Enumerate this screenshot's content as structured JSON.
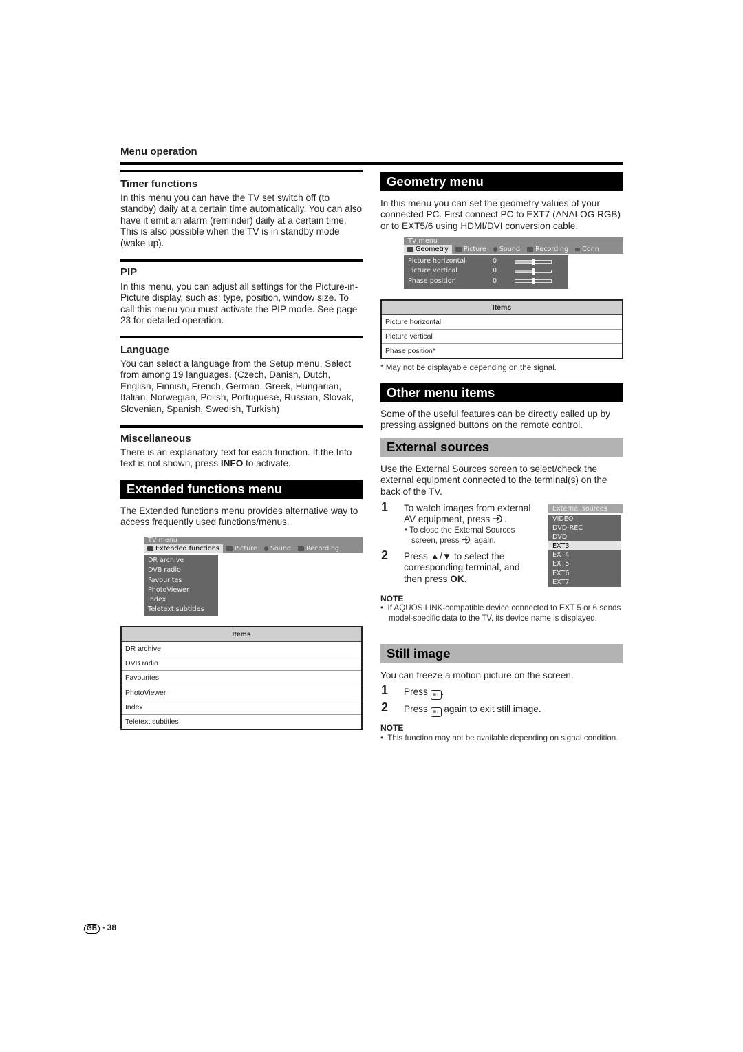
{
  "page": {
    "section_label": "Menu operation",
    "footer": {
      "region_badge": "GB",
      "page_number": "- 38"
    }
  },
  "left": {
    "timer": {
      "heading": "Timer functions",
      "body": "In this menu you can have the TV set switch off (to standby) daily at a certain time automatically. You can also have it emit an alarm (reminder) daily at a certain time. This is also possible when the TV is in standby mode (wake up)."
    },
    "pip": {
      "heading": "PIP",
      "body": "In this menu, you can adjust all settings for the Picture-in-Picture display, such as: type, position, window size. To call this menu you must activate the PIP mode. See page 23 for detailed operation."
    },
    "language": {
      "heading": "Language",
      "body": "You can select a language from the Setup menu. Select from among 19 languages. (Czech, Danish, Dutch, English, Finnish, French, German, Greek, Hungarian, Italian, Norwegian, Polish, Portuguese, Russian, Slovak, Slovenian, Spanish, Swedish, Turkish)"
    },
    "misc": {
      "heading": "Miscellaneous",
      "body_before": "There is an explanatory text for each function. If the Info text is not shown, press ",
      "body_bold": "INFO",
      "body_after": " to activate."
    },
    "extended": {
      "heading": "Extended functions menu",
      "body": "The Extended functions menu provides alternative way to access frequently used functions/menus.",
      "osd": {
        "title": "TV menu",
        "tabs": [
          "Extended functions",
          "Picture",
          "Sound",
          "Recording"
        ],
        "active_tab": "Extended functions",
        "items": [
          "DR archive",
          "DVB radio",
          "Favourites",
          "PhotoViewer",
          "Index",
          "Teletext subtitles"
        ]
      },
      "table": {
        "header": "Items",
        "rows": [
          "DR archive",
          "DVB radio",
          "Favourites",
          "PhotoViewer",
          "Index",
          "Teletext subtitles"
        ]
      }
    }
  },
  "right": {
    "geometry": {
      "heading": "Geometry menu",
      "body": "In this menu you can set the geometry values of your connected PC. First connect PC to EXT7 (ANALOG RGB) or to EXT5/6 using HDMI/DVI conversion cable.",
      "osd": {
        "title": "TV menu",
        "tabs": [
          "Geometry",
          "Picture",
          "Sound",
          "Recording",
          "Conn"
        ],
        "active_tab": "Geometry",
        "rows": [
          {
            "name": "Picture horizontal",
            "value": "0",
            "slider_fraction": 0.5
          },
          {
            "name": "Picture vertical",
            "value": "0",
            "slider_fraction": 0.5
          },
          {
            "name": "Phase position",
            "value": "0",
            "slider_fraction": 0.5
          }
        ]
      },
      "table": {
        "header": "Items",
        "rows": [
          "Picture horizontal",
          "Picture vertical",
          "Phase position*"
        ]
      },
      "footnote": "*  May not be displayable depending on the signal."
    },
    "other": {
      "heading": "Other menu items",
      "body": "Some of the useful features can be directly called up by pressing assigned buttons on the remote control."
    },
    "external": {
      "heading": "External sources",
      "body": "Use the External Sources screen to select/check the external equipment connected to the terminal(s) on the back of the TV.",
      "step1": {
        "num": "1",
        "text_a": "To watch images from external",
        "text_b": "AV equipment, press",
        "text_c": "."
      },
      "step1_bullet": {
        "text_a": "To close the External Sources",
        "text_b": "screen, press",
        "text_c": "again."
      },
      "step2": {
        "num": "2",
        "text_a": "Press ▲/▼ to select the",
        "text_b": "corresponding terminal, and",
        "text_c_before": "then press ",
        "text_c_bold": "OK",
        "text_c_after": "."
      },
      "osd": {
        "title": "External sources",
        "items": [
          "VIDEO",
          "DVD-REC",
          "DVD",
          "EXT3",
          "EXT4",
          "EXT5",
          "EXT6",
          "EXT7"
        ],
        "selected": "EXT3"
      },
      "note": {
        "heading": "NOTE",
        "text": "If AQUOS LINK-compatible device connected to EXT 5 or 6 sends model-specific data to the TV, its device name is displayed."
      }
    },
    "still": {
      "heading": "Still image",
      "body": "You can freeze a motion picture on the screen.",
      "step1": {
        "num": "1",
        "before": "Press",
        "after": "."
      },
      "step2": {
        "num": "2",
        "before": "Press",
        "after": "again to exit still image."
      },
      "note": {
        "heading": "NOTE",
        "text": "This function may not be available depending on signal condition."
      }
    }
  },
  "icons": {
    "input": "input-source-icon",
    "still": "still-image-icon"
  }
}
